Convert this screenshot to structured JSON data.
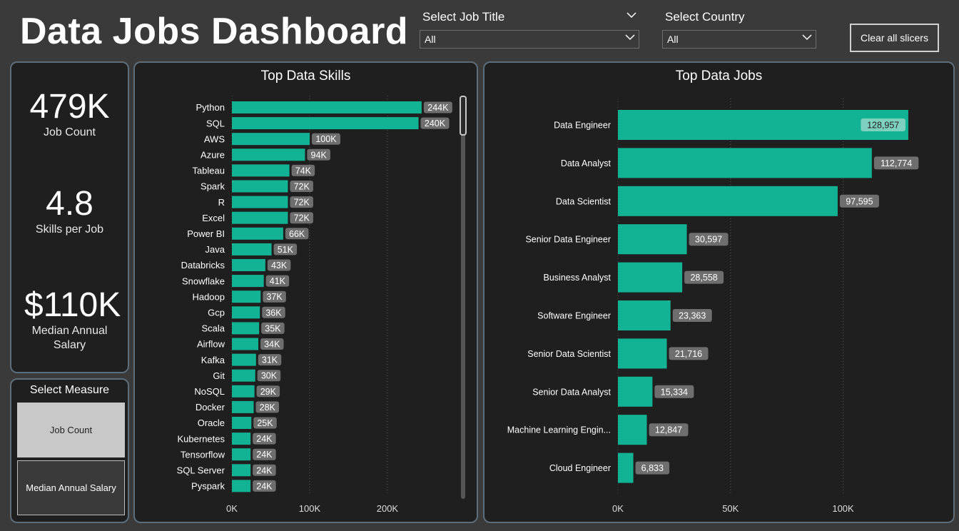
{
  "header": {
    "title": "Data Jobs Dashboard",
    "job_title_slicer": {
      "label": "Select Job Title",
      "value": "All"
    },
    "country_slicer": {
      "label": "Select Country",
      "value": "All"
    },
    "clear_button": "Clear all slicers"
  },
  "kpis": {
    "job_count": {
      "value": "479K",
      "label": "Job Count"
    },
    "skills_per_job": {
      "value": "4.8",
      "label": "Skills per Job"
    },
    "median_salary": {
      "value": "$110K",
      "label": "Median Annual Salary"
    }
  },
  "measure_selector": {
    "title": "Select Measure",
    "options": [
      "Job Count",
      "Median Annual Salary"
    ],
    "selected": "Job Count"
  },
  "colors": {
    "bar": "#12b394",
    "label_bg": "#6e6e6e",
    "card_bg": "#1f1f1f",
    "page_bg": "#3a3a3a"
  },
  "chart_data": [
    {
      "type": "bar",
      "orientation": "horizontal",
      "title": "Top Data Skills",
      "categories": [
        "Python",
        "SQL",
        "AWS",
        "Azure",
        "Tableau",
        "Spark",
        "R",
        "Excel",
        "Power BI",
        "Java",
        "Databricks",
        "Snowflake",
        "Hadoop",
        "Gcp",
        "Scala",
        "Airflow",
        "Kafka",
        "Git",
        "NoSQL",
        "Docker",
        "Oracle",
        "Kubernetes",
        "Tensorflow",
        "SQL Server",
        "Pyspark"
      ],
      "values": [
        244000,
        240000,
        100000,
        94000,
        74000,
        72000,
        72000,
        72000,
        66000,
        51000,
        43000,
        41000,
        37000,
        36000,
        35000,
        34000,
        31000,
        30000,
        29000,
        28000,
        25000,
        24000,
        24000,
        24000,
        24000
      ],
      "labels": [
        "244K",
        "240K",
        "100K",
        "94K",
        "74K",
        "72K",
        "72K",
        "72K",
        "66K",
        "51K",
        "43K",
        "41K",
        "37K",
        "36K",
        "35K",
        "34K",
        "31K",
        "30K",
        "29K",
        "28K",
        "25K",
        "24K",
        "24K",
        "24K",
        "24K"
      ],
      "xticks": [
        "0K",
        "100K",
        "200K"
      ],
      "xtick_values": [
        0,
        100000,
        200000
      ],
      "xlim": [
        0,
        290000
      ],
      "grid": "vertical dotted"
    },
    {
      "type": "bar",
      "orientation": "horizontal",
      "title": "Top Data Jobs",
      "categories": [
        "Data Engineer",
        "Data Analyst",
        "Data Scientist",
        "Senior Data Engineer",
        "Business Analyst",
        "Software Engineer",
        "Senior Data Scientist",
        "Senior Data Analyst",
        "Machine Learning Engin...",
        "Cloud Engineer"
      ],
      "values": [
        128957,
        112774,
        97595,
        30597,
        28558,
        23363,
        21716,
        15334,
        12847,
        6833
      ],
      "labels": [
        "128,957",
        "112,774",
        "97,595",
        "30,597",
        "28,558",
        "23,363",
        "21,716",
        "15,334",
        "12,847",
        "6,833"
      ],
      "xticks": [
        "0K",
        "50K",
        "100K"
      ],
      "xtick_values": [
        0,
        50000,
        100000
      ],
      "xlim": [
        0,
        148000
      ],
      "grid": "vertical dotted"
    }
  ]
}
